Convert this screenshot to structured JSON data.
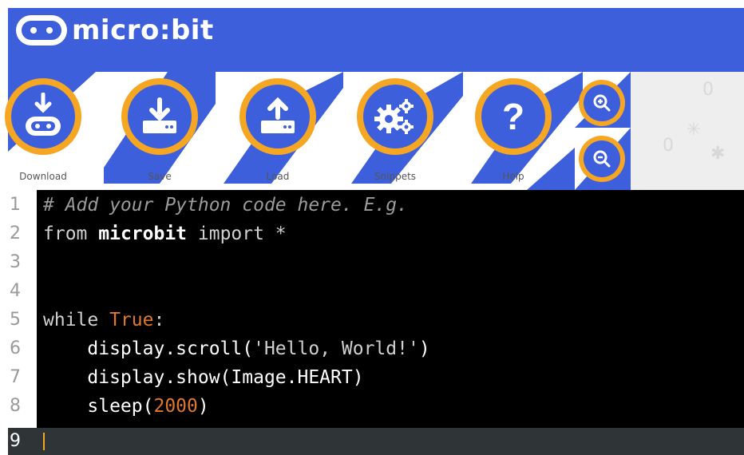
{
  "app": {
    "title": "micro:bit"
  },
  "toolbar": {
    "download_label": "Download",
    "save_label": "Save",
    "load_label": "Load",
    "snippets_label": "Snippets",
    "help_label": "Help"
  },
  "editor": {
    "line_numbers": [
      "1",
      "2",
      "3",
      "4",
      "5",
      "6",
      "7",
      "8",
      "9"
    ],
    "current_line": 9
  },
  "colors": {
    "brand_blue": "#3d5fdc",
    "accent_orange": "#f5a623",
    "editor_bg": "#000000"
  }
}
